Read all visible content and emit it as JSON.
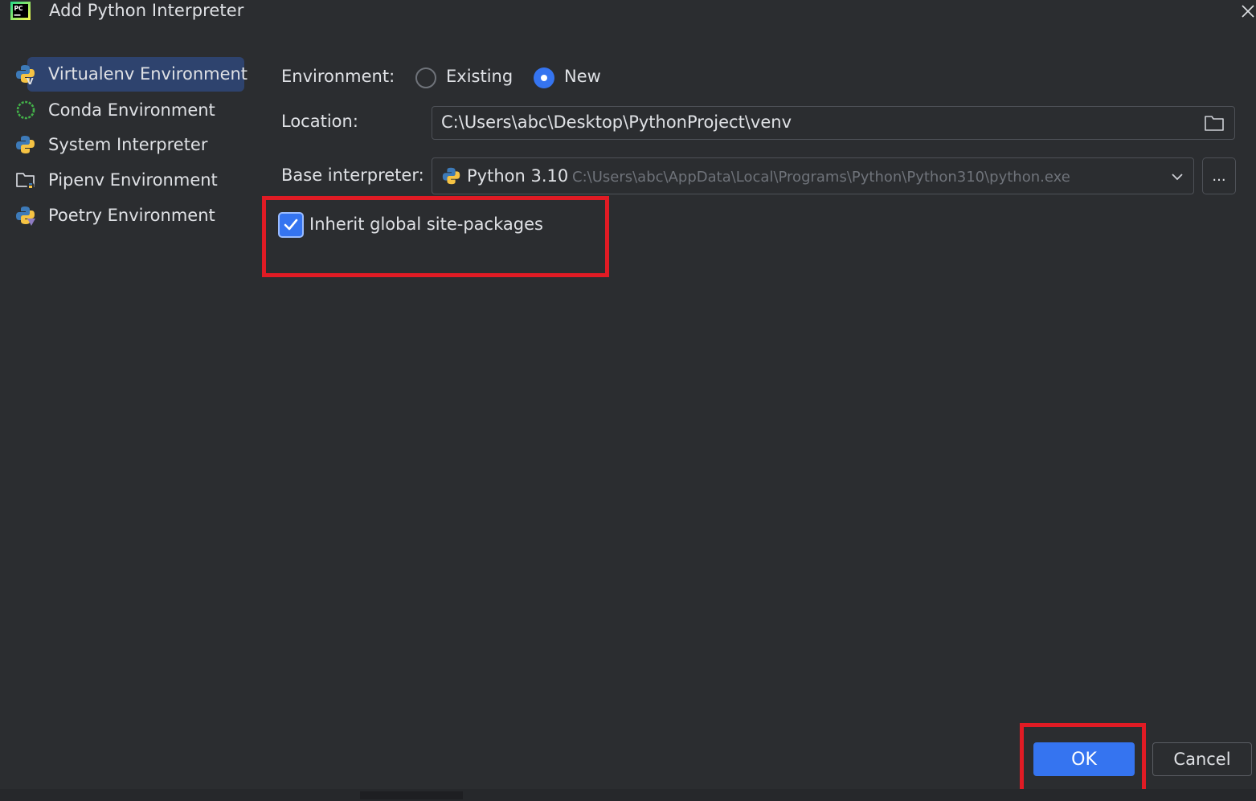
{
  "window": {
    "title": "Add Python Interpreter",
    "app_logo_text": "PC"
  },
  "sidebar": {
    "items": [
      {
        "label": "Virtualenv Environment",
        "icon": "virtualenv-icon",
        "selected": true
      },
      {
        "label": "Conda Environment",
        "icon": "conda-icon",
        "selected": false
      },
      {
        "label": "System Interpreter",
        "icon": "python-icon",
        "selected": false
      },
      {
        "label": "Pipenv Environment",
        "icon": "pipenv-folder-icon",
        "selected": false
      },
      {
        "label": "Poetry Environment",
        "icon": "poetry-icon",
        "selected": false
      }
    ]
  },
  "form": {
    "environment_label": "Environment:",
    "environment_options": [
      {
        "label": "Existing",
        "checked": false
      },
      {
        "label": "New",
        "checked": true
      }
    ],
    "location_label": "Location:",
    "location_value": "C:\\Users\\abc\\Desktop\\PythonProject\\venv",
    "base_interpreter_label": "Base interpreter:",
    "base_interpreter_name": "Python 3.10",
    "base_interpreter_path": "C:\\Users\\abc\\AppData\\Local\\Programs\\Python\\Python310\\python.exe",
    "browse_label": "...",
    "inherit_label": "Inherit global site-packages",
    "inherit_checked": true
  },
  "buttons": {
    "ok_label": "OK",
    "cancel_label": "Cancel"
  },
  "colors": {
    "background": "#2b2d30",
    "accent": "#3574f0",
    "highlight": "#e01b24",
    "selection": "#2e436e"
  }
}
